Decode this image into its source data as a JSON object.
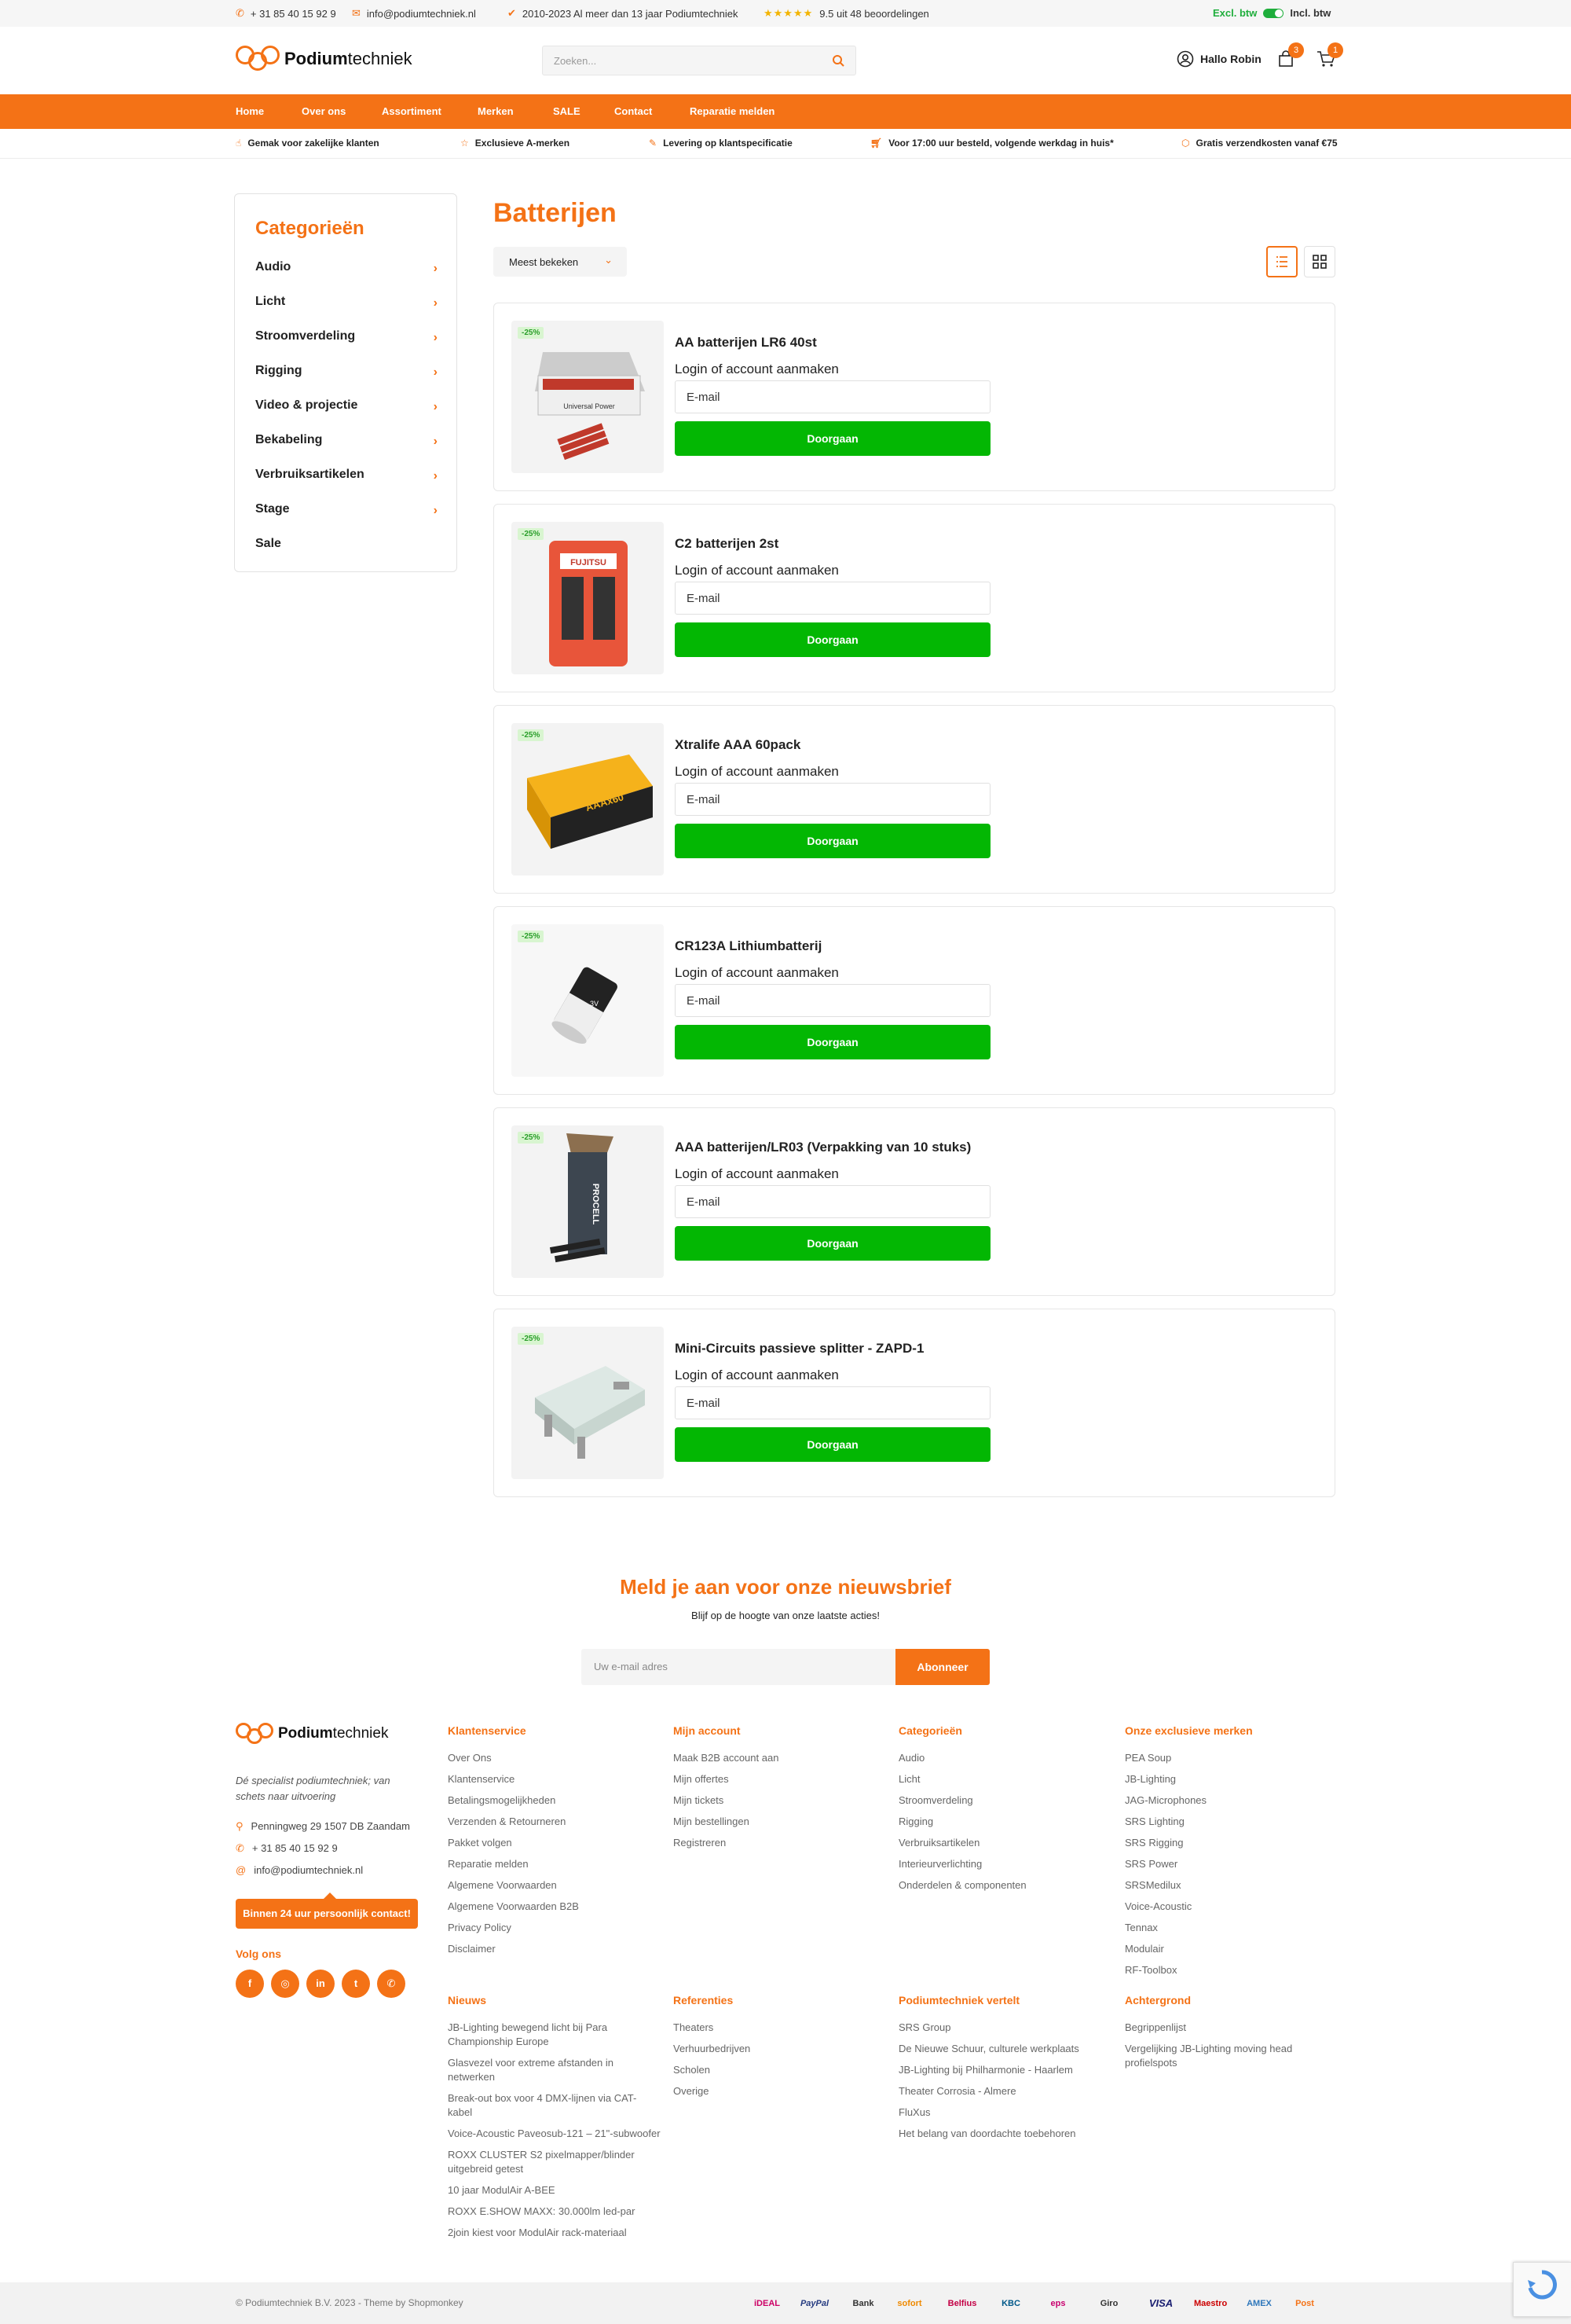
{
  "topbar": {
    "phone": "+ 31 85 40 15 92 9",
    "email": "info@podiumtechniek.nl",
    "years": "2010-2023 Al meer dan 13 jaar Podiumtechniek",
    "rating": "9.5 uit 48 beoordelingen",
    "excl": "Excl. btw",
    "incl": "Incl. btw"
  },
  "header": {
    "logo_bold": "Podium",
    "logo_thin": "techniek",
    "search_placeholder": "Zoeken...",
    "user_greeting": "Hallo Robin",
    "wishlist_count": "3",
    "cart_count": "1"
  },
  "nav": [
    "Home",
    "Over ons",
    "Assortiment",
    "Merken",
    "SALE",
    "Contact",
    "Reparatie melden"
  ],
  "usps": [
    "Gemak voor zakelijke klanten",
    "Exclusieve A-merken",
    "Levering op klantspecificatie",
    "Voor 17:00 uur besteld, volgende werkdag in huis*",
    "Gratis verzendkosten vanaf €75"
  ],
  "sidebar": {
    "title": "Categorieën",
    "items": [
      "Audio",
      "Licht",
      "Stroomverdeling",
      "Rigging",
      "Video & projectie",
      "Bekabeling",
      "Verbruiksartikelen",
      "Stage",
      "Sale"
    ]
  },
  "page": {
    "title": "Batterijen",
    "sort": "Meest bekeken"
  },
  "products": [
    {
      "name": "AA batterijen LR6 40st",
      "discount": "-25%",
      "login": "Login of account aanmaken",
      "email": "E-mail",
      "button": "Doorgaan",
      "thumb_text": "Universal Power"
    },
    {
      "name": "C2 batterijen 2st",
      "discount": "-25%",
      "login": "Login of account aanmaken",
      "email": "E-mail",
      "button": "Doorgaan",
      "thumb_text": "FUJITSU"
    },
    {
      "name": "Xtralife AAA 60pack",
      "discount": "-25%",
      "login": "Login of account aanmaken",
      "email": "E-mail",
      "button": "Doorgaan",
      "thumb_text": "AAAx60"
    },
    {
      "name": "CR123A Lithiumbatterij",
      "discount": "-25%",
      "login": "Login of account aanmaken",
      "email": "E-mail",
      "button": "Doorgaan",
      "thumb_text": "3V"
    },
    {
      "name": "AAA batterijen/LR03 (Verpakking van 10 stuks)",
      "discount": "-25%",
      "login": "Login of account aanmaken",
      "email": "E-mail",
      "button": "Doorgaan",
      "thumb_text": "PROCELL"
    },
    {
      "name": "Mini-Circuits passieve splitter - ZAPD-1",
      "discount": "-25%",
      "login": "Login of account aanmaken",
      "email": "E-mail",
      "button": "Doorgaan",
      "thumb_text": ""
    }
  ],
  "newsletter": {
    "title": "Meld je aan voor onze nieuwsbrief",
    "subtitle": "Blijf op de hoogte van onze laatste acties!",
    "placeholder": "Uw e-mail adres",
    "button": "Abonneer"
  },
  "footer": {
    "tagline": "Dé specialist podiumtechniek; van schets naar uitvoering",
    "address": "Penningweg 29  1507 DB Zaandam",
    "phone": "+ 31 85 40 15 92 9",
    "email": "info@podiumtechniek.nl",
    "contact_button": "Binnen 24 uur persoonlijk contact!",
    "follow": "Volg ons",
    "social": [
      "f",
      "◎",
      "in",
      "t",
      "✆"
    ],
    "klantenservice": {
      "title": "Klantenservice",
      "items": [
        "Over Ons",
        "Klantenservice",
        "Betalingsmogelijkheden",
        "Verzenden & Retourneren",
        "Pakket volgen",
        "Reparatie melden",
        "Algemene Voorwaarden",
        "Algemene Voorwaarden B2B",
        "Privacy Policy",
        "Disclaimer"
      ]
    },
    "account": {
      "title": "Mijn account",
      "items": [
        "Maak B2B account aan",
        "Mijn offertes",
        "Mijn tickets",
        "Mijn bestellingen",
        "Registreren"
      ]
    },
    "categorieen": {
      "title": "Categorieën",
      "items": [
        "Audio",
        "Licht",
        "Stroomverdeling",
        "Rigging",
        "Verbruiksartikelen",
        "Interieurverlichting",
        "Onderdelen & componenten"
      ]
    },
    "merken": {
      "title": "Onze exclusieve merken",
      "items": [
        "PEA Soup",
        "JB-Lighting",
        "JAG-Microphones",
        "SRS Lighting",
        "SRS Rigging",
        "SRS Power",
        "SRSMedilux",
        "Voice-Acoustic",
        "Tennax",
        "Modulair",
        "RF-Toolbox"
      ]
    },
    "nieuws": {
      "title": "Nieuws",
      "items": [
        "JB-Lighting bewegend licht bij Para Championship Europe",
        "Glasvezel voor extreme afstanden in netwerken",
        "Break-out box voor 4 DMX-lijnen via CAT-kabel",
        "Voice-Acoustic Paveosub-121 – 21\"-subwoofer",
        "ROXX CLUSTER S2 pixelmapper/blinder uitgebreid getest",
        "10 jaar ModulAir A-BEE",
        "ROXX E.SHOW MAXX: 30.000lm led-par",
        "2join kiest voor ModulAir rack-materiaal"
      ]
    },
    "referenties": {
      "title": "Referenties",
      "items": [
        "Theaters",
        "Verhuurbedrijven",
        "Scholen",
        "Overige"
      ]
    },
    "vertelt": {
      "title": "Podiumtechniek vertelt",
      "items": [
        "SRS Group",
        "De Nieuwe Schuur, culturele werkplaats",
        "JB-Lighting bij Philharmonie - Haarlem",
        "Theater Corrosia - Almere",
        "FluXus",
        "Het belang van doordachte toebehoren"
      ]
    },
    "achtergrond": {
      "title": "Achtergrond",
      "items": [
        "Begrippenlijst",
        "Vergelijking JB-Lighting moving head profielspots"
      ]
    }
  },
  "bottom": {
    "copyright": "© Podiumtechniek B.V. 2023 - Theme by Shopmonkey",
    "payments": [
      "iDEAL",
      "PayPal",
      "Bank",
      "sofort",
      "Belfius",
      "KBC",
      "eps",
      "Giro",
      "VISA",
      "Maestro",
      "AMEX",
      "Post"
    ]
  },
  "colors": {
    "accent": "#f47216",
    "green": "#03b703"
  }
}
